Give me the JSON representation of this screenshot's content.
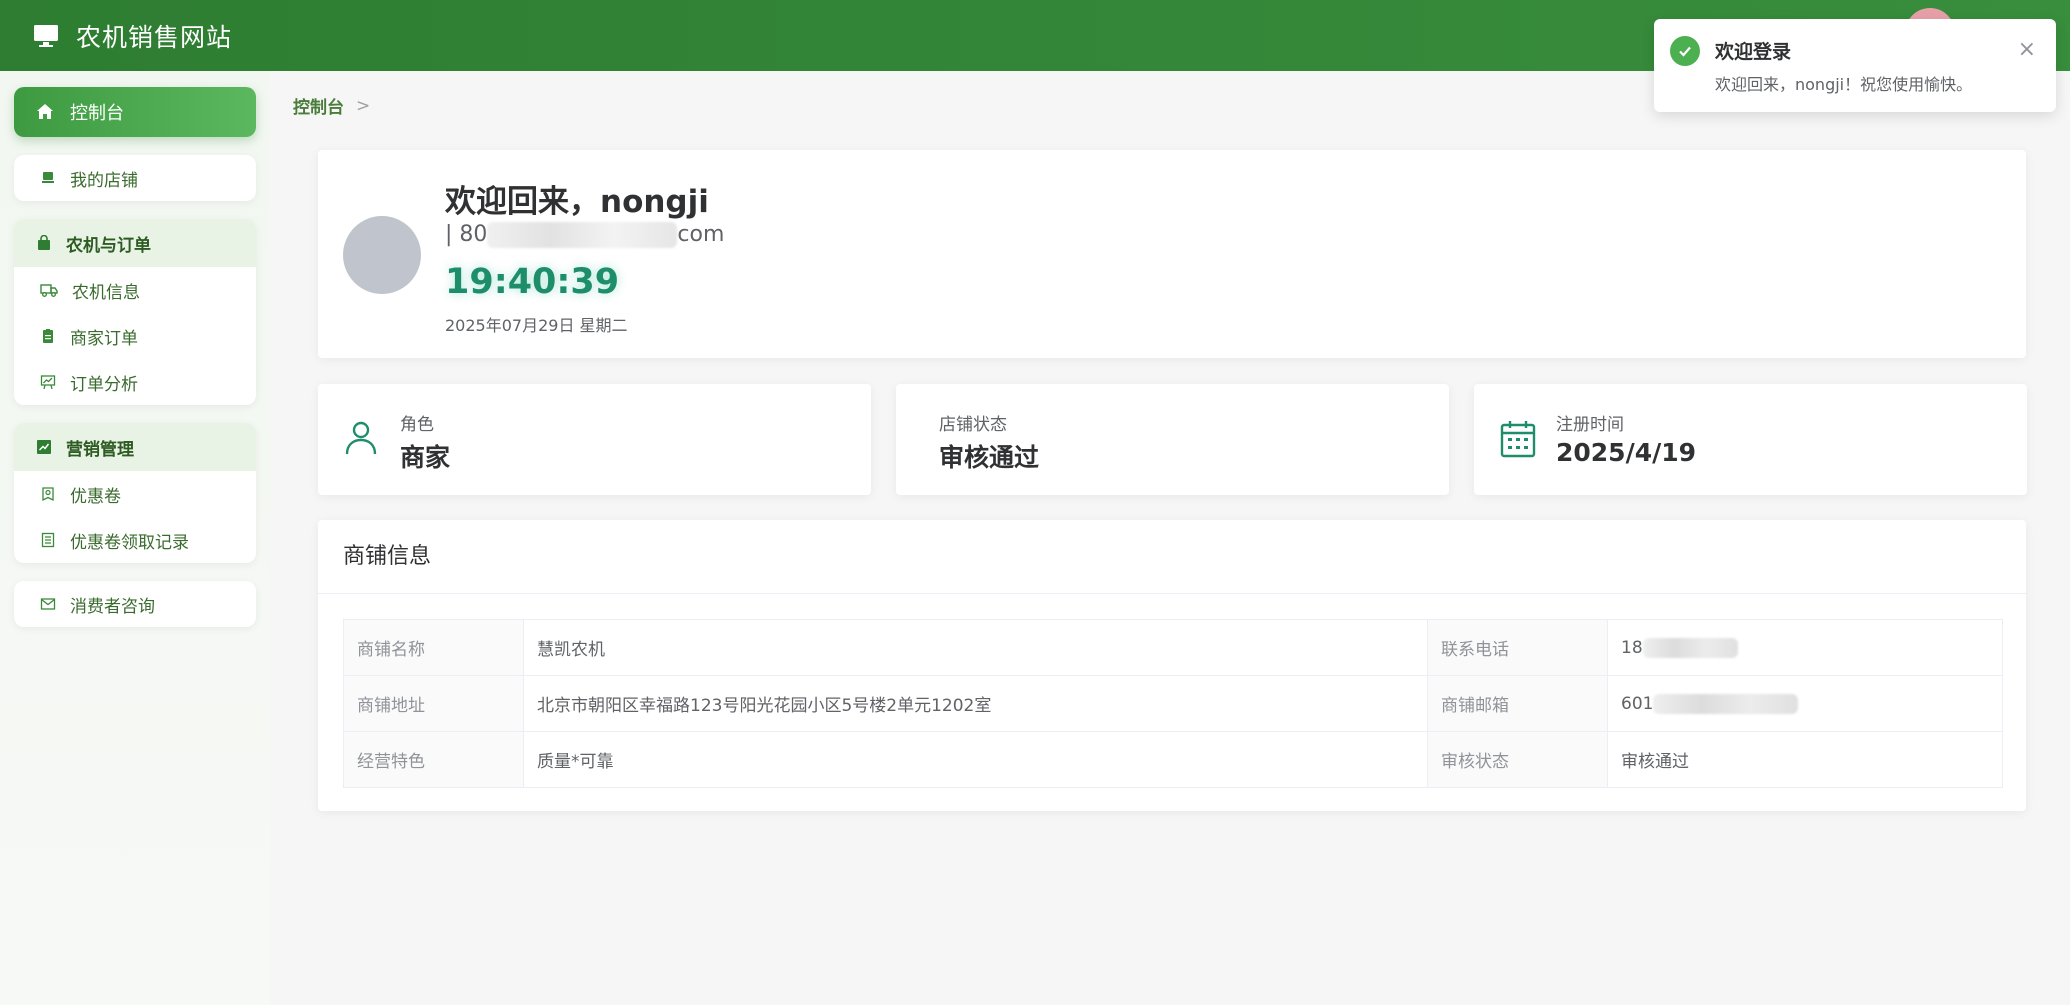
{
  "header": {
    "site_title": "农机销售网站",
    "logo_icon": "monitor-icon"
  },
  "sidebar": {
    "active": {
      "label": "控制台",
      "icon": "home-icon"
    },
    "my_shop": {
      "label": "我的店铺",
      "icon": "shop-icon"
    },
    "group_machinery": {
      "title": "农机与订单",
      "icon": "bag-icon",
      "items": [
        {
          "label": "农机信息",
          "icon": "truck-icon"
        },
        {
          "label": "商家订单",
          "icon": "clipboard-icon"
        },
        {
          "label": "订单分析",
          "icon": "chart-board-icon"
        }
      ]
    },
    "group_marketing": {
      "title": "营销管理",
      "icon": "trend-icon",
      "items": [
        {
          "label": "优惠卷",
          "icon": "coupon-icon"
        },
        {
          "label": "优惠卷领取记录",
          "icon": "list-icon"
        }
      ]
    },
    "consult": {
      "label": "消费者咨询",
      "icon": "mail-icon"
    }
  },
  "breadcrumb": {
    "current": "控制台",
    "separator": ">"
  },
  "welcome": {
    "greeting": "欢迎回来，nongji",
    "email_prefix": "| 80",
    "email_suffix": "com",
    "clock": "19:40:39",
    "date": "2025年07月29日 星期二"
  },
  "stats": [
    {
      "label": "角色",
      "value": "商家",
      "icon": "user-icon"
    },
    {
      "label": "店铺状态",
      "value": "审核通过"
    },
    {
      "label": "注册时间",
      "value": "2025/4/19",
      "icon": "calendar-icon"
    }
  ],
  "shop_info": {
    "title": "商铺信息",
    "rows": [
      {
        "l1": "商铺名称",
        "v1": "慧凯农机",
        "l2": "联系电话",
        "v2": "18"
      },
      {
        "l1": "商铺地址",
        "v1": "北京市朝阳区幸福路123号阳光花园小区5号楼2单元1202室",
        "l2": "商铺邮箱",
        "v2": "601"
      },
      {
        "l1": "经营特色",
        "v1": "质量*可靠",
        "l2": "审核状态",
        "v2": "审核通过"
      }
    ]
  },
  "toast": {
    "title": "欢迎登录",
    "message": "欢迎回来，nongji！祝您使用愉快。",
    "close": "×"
  },
  "colors": {
    "header": "#2e7d32",
    "accent": "#4caf50",
    "clock": "#1e8d6a"
  }
}
